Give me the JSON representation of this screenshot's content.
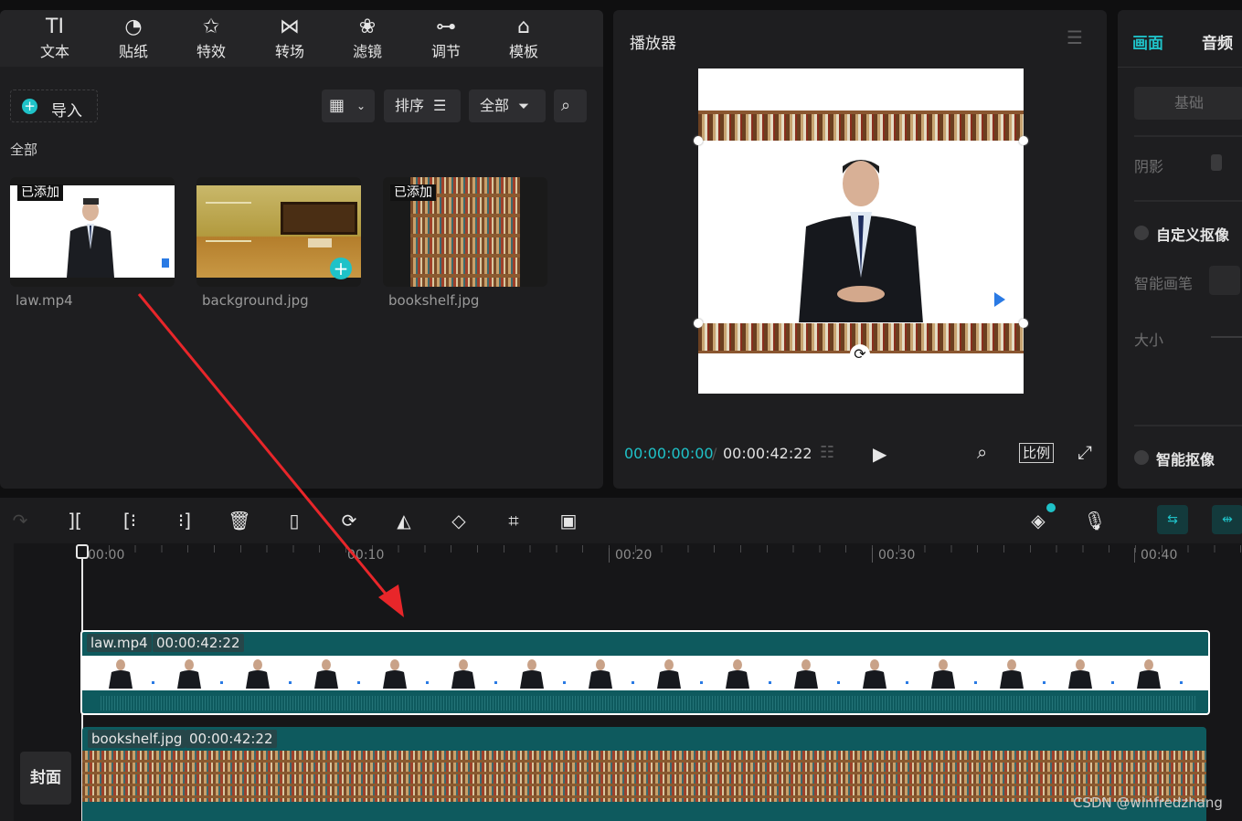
{
  "media_panel": {
    "tabs": [
      {
        "label": "文本",
        "icon": "text-icon",
        "glyph": "TI"
      },
      {
        "label": "贴纸",
        "icon": "sticker-icon",
        "glyph": "◔"
      },
      {
        "label": "特效",
        "icon": "effects-star-icon",
        "glyph": "✩"
      },
      {
        "label": "转场",
        "icon": "transition-icon",
        "glyph": "⋈"
      },
      {
        "label": "滤镜",
        "icon": "filter-icon",
        "glyph": "❀"
      },
      {
        "label": "调节",
        "icon": "adjust-sliders-icon",
        "glyph": "⊶"
      },
      {
        "label": "模板",
        "icon": "template-icon",
        "glyph": "⌂"
      }
    ],
    "import_label": "导入",
    "sort_label": "排序",
    "filter_label": "全部",
    "section_title": "全部",
    "items": [
      {
        "name": "law.mp4",
        "badge": "已添加"
      },
      {
        "name": "background.jpg",
        "badge": ""
      },
      {
        "name": "bookshelf.jpg",
        "badge": "已添加"
      }
    ]
  },
  "player": {
    "title": "播放器",
    "current_time": "00:00:00:00",
    "total_time": "00:00:42:22",
    "ratio_label": "比例"
  },
  "properties": {
    "tabs": [
      "画面",
      "音频"
    ],
    "sub_tab": "基础",
    "shadow_label": "阴影",
    "custom_matting_label": "自定义抠像",
    "smart_brush_label": "智能画笔",
    "size_label": "大小",
    "smart_matting_label": "智能抠像"
  },
  "timeline": {
    "ruler": [
      "00:00",
      "00:10",
      "00:20",
      "00:30",
      "00:40"
    ],
    "tracks": [
      {
        "name": "law.mp4",
        "duration": "00:00:42:22"
      },
      {
        "name": "bookshelf.jpg",
        "duration": "00:00:42:22"
      }
    ],
    "cover_label": "封面"
  },
  "watermark": "CSDN @winfredzhang",
  "colors": {
    "accent": "#1fc2c8",
    "track_bg": "#0e5a5e",
    "arrow": "#e8262a"
  }
}
